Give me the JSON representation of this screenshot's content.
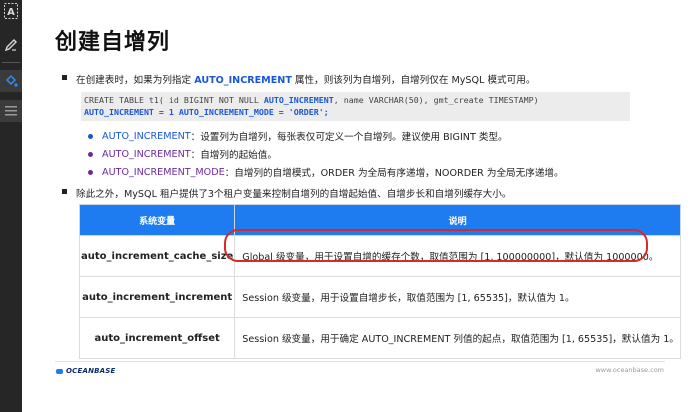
{
  "toolbar": {
    "tools": [
      {
        "name": "text-tool-icon"
      },
      {
        "name": "pen-tool-icon"
      },
      {
        "name": "fill-tool-icon"
      },
      {
        "name": "lines-tool-icon"
      }
    ]
  },
  "slide": {
    "title": "创建自增列",
    "bullet1": {
      "pre": "在创建表时，如果为列指定 ",
      "keyword": "AUTO_INCREMENT",
      "post": " 属性，则该列为自增列，自增列仅在 MySQL 模式可用。"
    },
    "code": {
      "line1_pre": "CREATE TABLE t1( id BIGINT NOT NULL ",
      "line1_kw": "AUTO_INCREMENT",
      "line1_post": ", name VARCHAR(50), gmt_create TIMESTAMP)",
      "line2": " AUTO_INCREMENT = 1 AUTO_INCREMENT_MODE = 'ORDER';"
    },
    "sub_bullets": [
      {
        "key": "AUTO_INCREMENT",
        "text": "：设置列为自增列，每张表仅可定义一个自增列。建议使用 BIGINT 类型。",
        "color": "#1a56d8"
      },
      {
        "key": "AUTO_INCREMENT",
        "text": "：自增列的起始值。",
        "color": "#6a2aa0"
      },
      {
        "key": "AUTO_INCREMENT_MODE",
        "text": "：自增列的自增模式，ORDER 为全局有序递增，NOORDER 为全局无序递增。",
        "color": "#6a2aa0"
      }
    ],
    "bullet2": "除此之外，MySQL 租户提供了3个租户变量来控制自增列的自增起始值、自增步长和自增列缓存大小。",
    "table": {
      "headers": [
        "系统变量",
        "说明"
      ],
      "rows": [
        {
          "key": "auto_increment_cache_size",
          "desc": "Global 级变量，用于设置自增的缓存个数，取值范围为 [1, 100000000]，默认值为 1000000。"
        },
        {
          "key": "auto_increment_increment",
          "desc": "Session 级变量，用于设置自增步长，取值范围为 [1, 65535]，默认值为 1。"
        },
        {
          "key": "auto_increment_offset",
          "desc": "Session 级变量，用于确定 AUTO_INCREMENT 列值的起点，取值范围为 [1, 65535]，默认值为 1。"
        }
      ]
    },
    "footer": {
      "logo": "OCEANBASE",
      "url": "www.oceanbase.com"
    }
  },
  "colors": {
    "accent": "#1a56d8",
    "purple": "#6a2aa0",
    "table_header": "#1f7cf0",
    "highlight": "#d32a2a"
  }
}
